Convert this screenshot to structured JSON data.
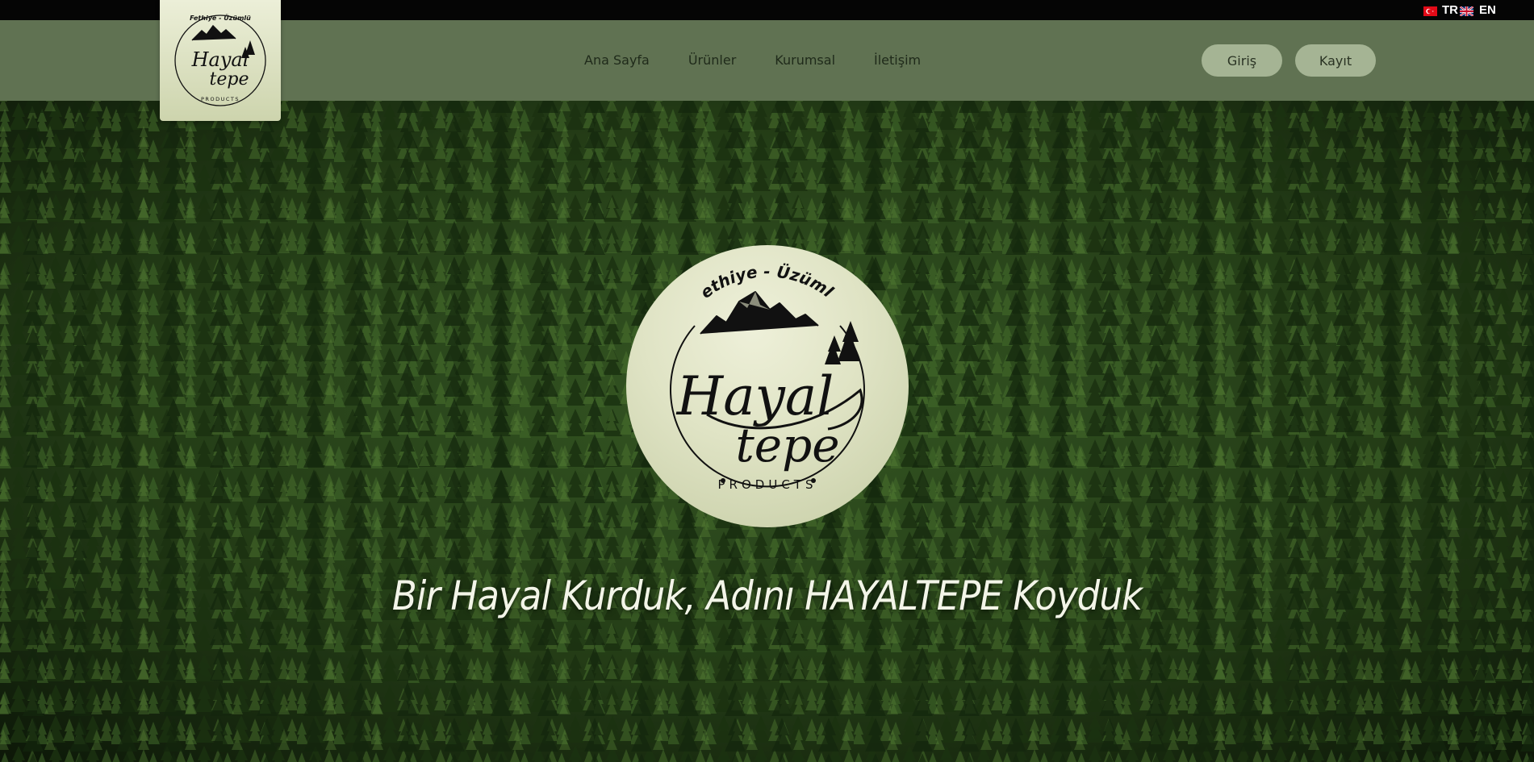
{
  "language_bar": {
    "languages": [
      {
        "code": "TR",
        "flag_icon": "turkey-flag-icon"
      },
      {
        "code": "EN",
        "flag_icon": "uk-flag-icon"
      }
    ]
  },
  "logo": {
    "top_text": "Fethiye - Üzümlü",
    "brand_line1": "Hayal",
    "brand_line2": "tepe",
    "bottom_text": "PRODUCTS"
  },
  "nav": {
    "items": [
      {
        "label": "Ana Sayfa"
      },
      {
        "label": "Ürünler"
      },
      {
        "label": "Kurumsal"
      },
      {
        "label": "İletişim"
      }
    ],
    "login_label": "Giriş",
    "register_label": "Kayıt"
  },
  "hero": {
    "tagline": "Bir Hayal Kurduk, Adını HAYALTEPE Koyduk"
  },
  "colors": {
    "topbar": "#050505",
    "navbar": "#607252",
    "button": "#a5b494",
    "logo_bg": "#e4e8cc",
    "forest": "#1f3a15"
  }
}
